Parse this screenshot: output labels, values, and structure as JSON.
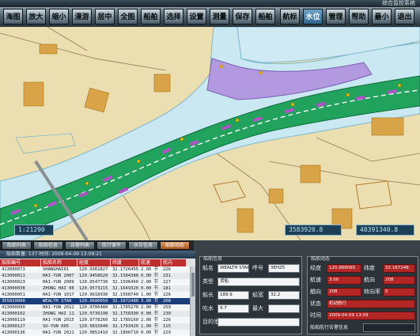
{
  "app": {
    "title": "综合监控系统"
  },
  "toolbar": [
    {
      "label": "海图",
      "active": false
    },
    {
      "label": "放大",
      "active": false
    },
    {
      "label": "缩小",
      "active": false
    },
    {
      "label": "漫游",
      "active": false
    },
    {
      "label": "居中",
      "active": false
    },
    {
      "label": "全图",
      "active": false
    },
    {
      "label": "船舶",
      "active": false
    },
    {
      "label": "选择",
      "active": false
    },
    {
      "label": "设置",
      "active": false
    },
    {
      "label": "测量",
      "active": false
    },
    {
      "label": "保存",
      "active": false
    },
    {
      "label": "船舶",
      "active": false
    },
    {
      "label": "航标",
      "active": false
    },
    {
      "label": "水位",
      "active": true
    },
    {
      "label": "管理",
      "active": false
    },
    {
      "label": "帮助",
      "active": false
    },
    {
      "label": "最小",
      "active": false
    },
    {
      "label": "退出",
      "active": false
    }
  ],
  "map": {
    "scale": "1:21290",
    "coord_x": "3583920.8",
    "coord_y": "40391340.8"
  },
  "tabs": [
    "船舶列表",
    "船舶信息",
    "告警列表",
    "航行事件",
    "水位信息",
    "船舶动态"
  ],
  "list": {
    "header": "船舶数量: 137  时间: 2009-04-09 13:09:21",
    "columns": [
      "船舶编号",
      "船舶名称",
      "经度",
      "纬度",
      "航速",
      "航向"
    ],
    "rows": [
      [
        "413000073",
        "SHANGHAI01",
        "120.9361827",
        "32.1726455",
        "2.00 节",
        "226"
      ],
      [
        "413000011",
        "HAI-YUN 2007",
        "120.9458620",
        "32.1584380",
        "0.00 节",
        "231"
      ],
      [
        "413000023",
        "HAI-YUN 2009",
        "120.9547730",
        "32.1596460",
        "2.00 节",
        "227"
      ],
      [
        "413000038",
        "ZHONG HAI 08",
        "120.9573215",
        "32.1649320",
        "0.00 节",
        "181"
      ],
      [
        "413000051",
        "HAI-YUN 1017",
        "120.9618930",
        "32.1568740",
        "1.00 节",
        "226"
      ],
      [
        "355029000",
        "WEALTH STAR",
        "120.9680650",
        "32.1672480",
        "3.00 节",
        "208"
      ],
      [
        "413000090",
        "HAI-YUN 2012",
        "120.9706480",
        "32.1705270",
        "2.00 节",
        "259"
      ],
      [
        "413000102",
        "ZHONG HAI 11",
        "120.9739190",
        "32.1758390",
        "0.00 节",
        "230"
      ],
      [
        "413000119",
        "HAI-YUN 2015",
        "120.9778260",
        "32.1789160",
        "2.00 节",
        "226"
      ],
      [
        "413000127",
        "SU-YUN 005",
        "120.9815640",
        "32.1793420",
        "1.00 节",
        "115"
      ],
      [
        "413000136",
        "HAI-YUN 2021",
        "120.9852410",
        "32.1806710",
        "0.00 节",
        "229"
      ]
    ],
    "selected_index": 5
  },
  "ship_info": {
    "title": "船舶信息",
    "rows": [
      {
        "l1": "船名",
        "v1": "WEALTH STAR",
        "l2": "呼号",
        "v2": "3EHZ5"
      },
      {
        "l1": "类型",
        "v1": "货船",
        "l2": "",
        "v2": ""
      },
      {
        "l1": "船长",
        "v1": "189.9",
        "l2": "船宽",
        "v2": "32.2"
      },
      {
        "l1": "吃水",
        "v1": "9.7",
        "l2": "最大",
        "v2": ""
      },
      {
        "l1": "目的港",
        "v1": "",
        "l2": "",
        "v2": ""
      }
    ]
  },
  "dynamics": {
    "title": "船舶动态",
    "rows": [
      {
        "l1": "经度",
        "v1": "120.968065",
        "l2": "纬度",
        "v2": "32.167248"
      },
      {
        "l1": "航速",
        "v1": "3.00",
        "l2": "航向",
        "v2": "208"
      },
      {
        "l1": "艏向",
        "v1": "208",
        "l2": "转向率",
        "v2": "0"
      },
      {
        "l1": "状态",
        "v1": "机动航行",
        "l2": "",
        "v2": ""
      },
      {
        "l1": "时间",
        "v1": "2009-04-09 13:09",
        "l2": "",
        "v2": ""
      }
    ],
    "footer_label": "船舶航行告警信息"
  },
  "colors": {
    "land": "#e9ddb0",
    "river": "#c6e8f2",
    "channel": "#1fa860",
    "route": "#ffffff",
    "dredge": "#a974d6",
    "accent": "#bf2e2e"
  }
}
